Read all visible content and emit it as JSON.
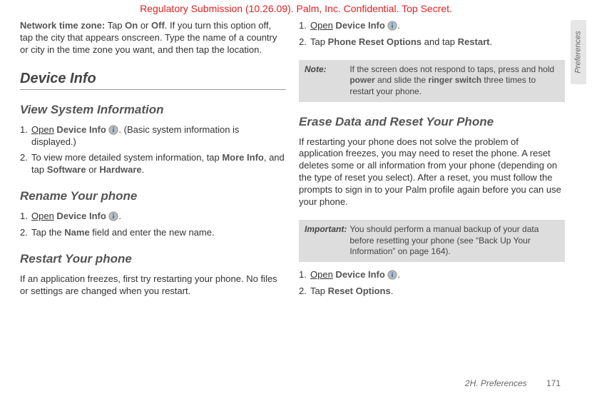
{
  "watermark": "Regulatory Submission (10.26.09). Palm, Inc. Confidential. Top Secret.",
  "sidetab": "Preferences",
  "footer": {
    "section": "2H. Preferences",
    "page": "171"
  },
  "left": {
    "ntz_intro_bold": "Network time zone:",
    "ntz_intro_1": " Tap ",
    "on": "On",
    "ntz_intro_2": " or ",
    "off": "Off",
    "ntz_intro_3": ". If you turn this option off, tap the city that appears onscreen. Type the name of a country or city in the time zone you want, and then tap the location.",
    "h2_device_info": "Device Info",
    "h3_view_sys": "View System Information",
    "vs_1_open": "Open",
    "vs_1_devinfo": " Device Info ",
    "vs_1_tail": ". (Basic system information is displayed.)",
    "vs_2_1": "To view more detailed system information, tap ",
    "vs_2_more": "More Info",
    "vs_2_2": ", and tap ",
    "vs_2_sw": "Software",
    "vs_2_3": " or ",
    "vs_2_hw": "Hardware",
    "vs_2_4": ".",
    "h3_rename": "Rename Your phone",
    "rn_1_open": "Open",
    "rn_1_devinfo": " Device Info ",
    "rn_1_dot": ".",
    "rn_2_1": "Tap the ",
    "rn_2_name": "Name",
    "rn_2_2": " field and enter the new name.",
    "h3_restart": "Restart Your phone",
    "restart_para": "If an application freezes, first try restarting your phone. No files or settings are changed when you restart."
  },
  "right": {
    "rs_1_open": "Open",
    "rs_1_devinfo": " Device Info ",
    "rs_1_dot": ".",
    "rs_2_1": "Tap ",
    "rs_2_pro": "Phone Reset Options",
    "rs_2_2": " and tap ",
    "rs_2_restart": "Restart",
    "rs_2_3": ".",
    "note_label": "Note:",
    "note_1": "If the screen does not respond to taps, press and hold ",
    "note_power": "power",
    "note_2": " and slide the ",
    "note_ringer": "ringer switch",
    "note_3": " three times to restart your phone.",
    "h3_erase": "Erase Data and Reset Your Phone",
    "erase_para": "If restarting your phone does not solve the problem of application freezes, you may need to reset the phone. A reset deletes some or all information from your phone (depending on the type of reset you select). After a reset, you must follow the prompts to sign in to your Palm profile again before you can use your phone.",
    "imp_label": "Important:",
    "imp_body": "You should perform a manual backup of your data before resetting your phone (see “Back Up Your Information” on page 164).",
    "er_1_open": "Open",
    "er_1_devinfo": " Device Info ",
    "er_1_dot": ".",
    "er_2_1": "Tap ",
    "er_2_ro": "Reset Options",
    "er_2_2": "."
  }
}
